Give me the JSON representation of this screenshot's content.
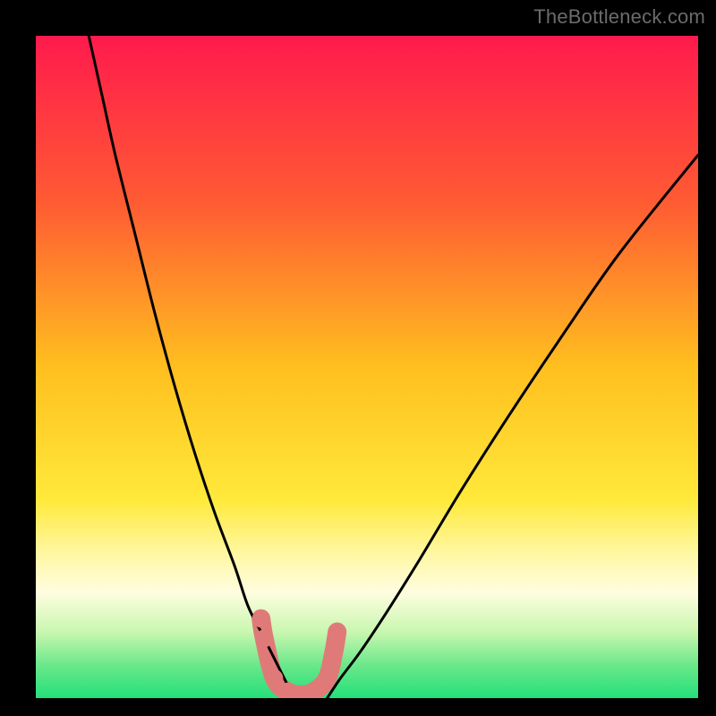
{
  "watermark": "TheBottleneck.com",
  "chart_data": {
    "type": "line",
    "title": "",
    "xlabel": "",
    "ylabel": "",
    "xlim": [
      0,
      100
    ],
    "ylim": [
      0,
      100
    ],
    "series": [
      {
        "name": "curve-left",
        "x": [
          8,
          10,
          12,
          15,
          18,
          21,
          24,
          27,
          30,
          32,
          34,
          36,
          37,
          38,
          39
        ],
        "values": [
          100,
          91,
          82,
          70,
          58,
          47,
          37,
          28,
          20,
          14,
          10,
          6,
          4,
          2,
          0
        ]
      },
      {
        "name": "curve-right",
        "x": [
          44,
          46,
          49,
          53,
          58,
          64,
          71,
          79,
          88,
          100
        ],
        "values": [
          0,
          3,
          7,
          13,
          21,
          31,
          42,
          54,
          67,
          82
        ]
      },
      {
        "name": "valley-markers",
        "x": [
          34,
          34.5,
          36,
          38,
          40,
          42,
          44,
          45,
          45.5
        ],
        "values": [
          12,
          9,
          3,
          1,
          0.5,
          1,
          3,
          7,
          10
        ]
      }
    ],
    "gradient_stops": [
      {
        "offset": 0.0,
        "color": "#ff1a4d"
      },
      {
        "offset": 0.25,
        "color": "#ff5a33"
      },
      {
        "offset": 0.5,
        "color": "#ffbf1f"
      },
      {
        "offset": 0.7,
        "color": "#ffe93a"
      },
      {
        "offset": 0.78,
        "color": "#fff7a0"
      },
      {
        "offset": 0.84,
        "color": "#fffde0"
      },
      {
        "offset": 0.9,
        "color": "#c9f7b0"
      },
      {
        "offset": 0.95,
        "color": "#6be88a"
      },
      {
        "offset": 1.0,
        "color": "#23e07a"
      }
    ],
    "curve_style": {
      "stroke": "#000000",
      "stroke_width": 3
    },
    "marker_style": {
      "fill": "#e07a78",
      "radius": 10
    }
  }
}
